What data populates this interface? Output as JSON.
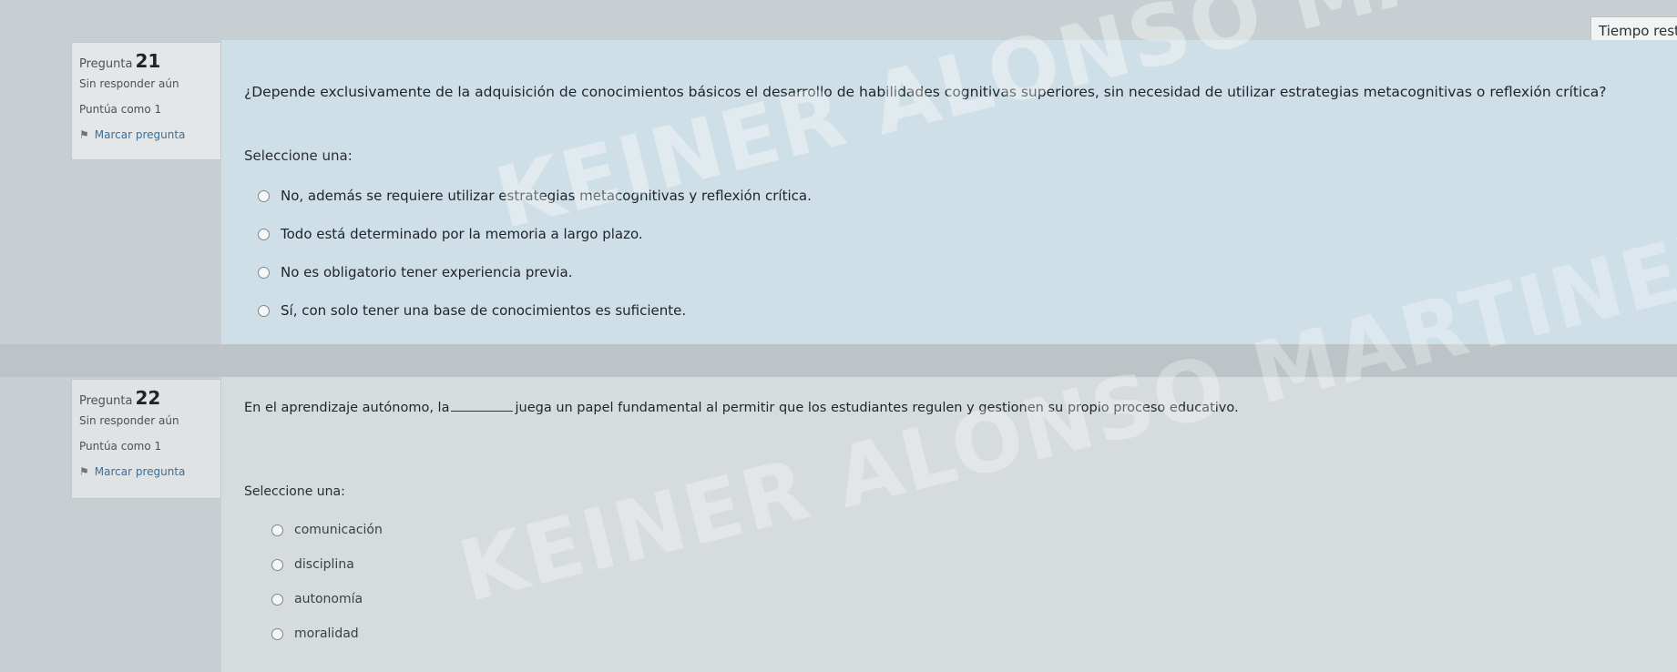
{
  "timer": {
    "label": "Tiempo rest"
  },
  "q21": {
    "label": "Pregunta",
    "number": "21",
    "status": "Sin responder aún",
    "points": "Puntúa como 1",
    "flag": "Marcar pregunta",
    "text": "¿Depende exclusivamente de la adquisición de conocimientos básicos el desarrollo de habilidades cognitivas superiores, sin necesidad de utilizar estrategias metacognitivas o reflexión crítica?",
    "prompt": "Seleccione una:",
    "options": [
      "No, además se requiere utilizar estrategias metacognitivas y reflexión crítica.",
      "Todo está determinado por la memoria a largo plazo.",
      "No es obligatorio tener experiencia previa.",
      "Sí, con solo tener una base de conocimientos es suficiente."
    ]
  },
  "q22": {
    "label": "Pregunta",
    "number": "22",
    "status": "Sin responder aún",
    "points": "Puntúa como 1",
    "flag": "Marcar pregunta",
    "text_before": "En el aprendizaje autónomo, la",
    "text_after": "juega un papel fundamental al permitir que los estudiantes regulen y gestionen su propio proceso educativo.",
    "prompt": "Seleccione una:",
    "options": [
      "comunicación",
      "disciplina",
      "autonomía",
      "moralidad"
    ]
  },
  "watermark": {
    "line1": "KEINER ALONSO MARTINEZ ALFONSO",
    "line2": "KEINER ALONSO MARTINEZ ALFONSO"
  }
}
